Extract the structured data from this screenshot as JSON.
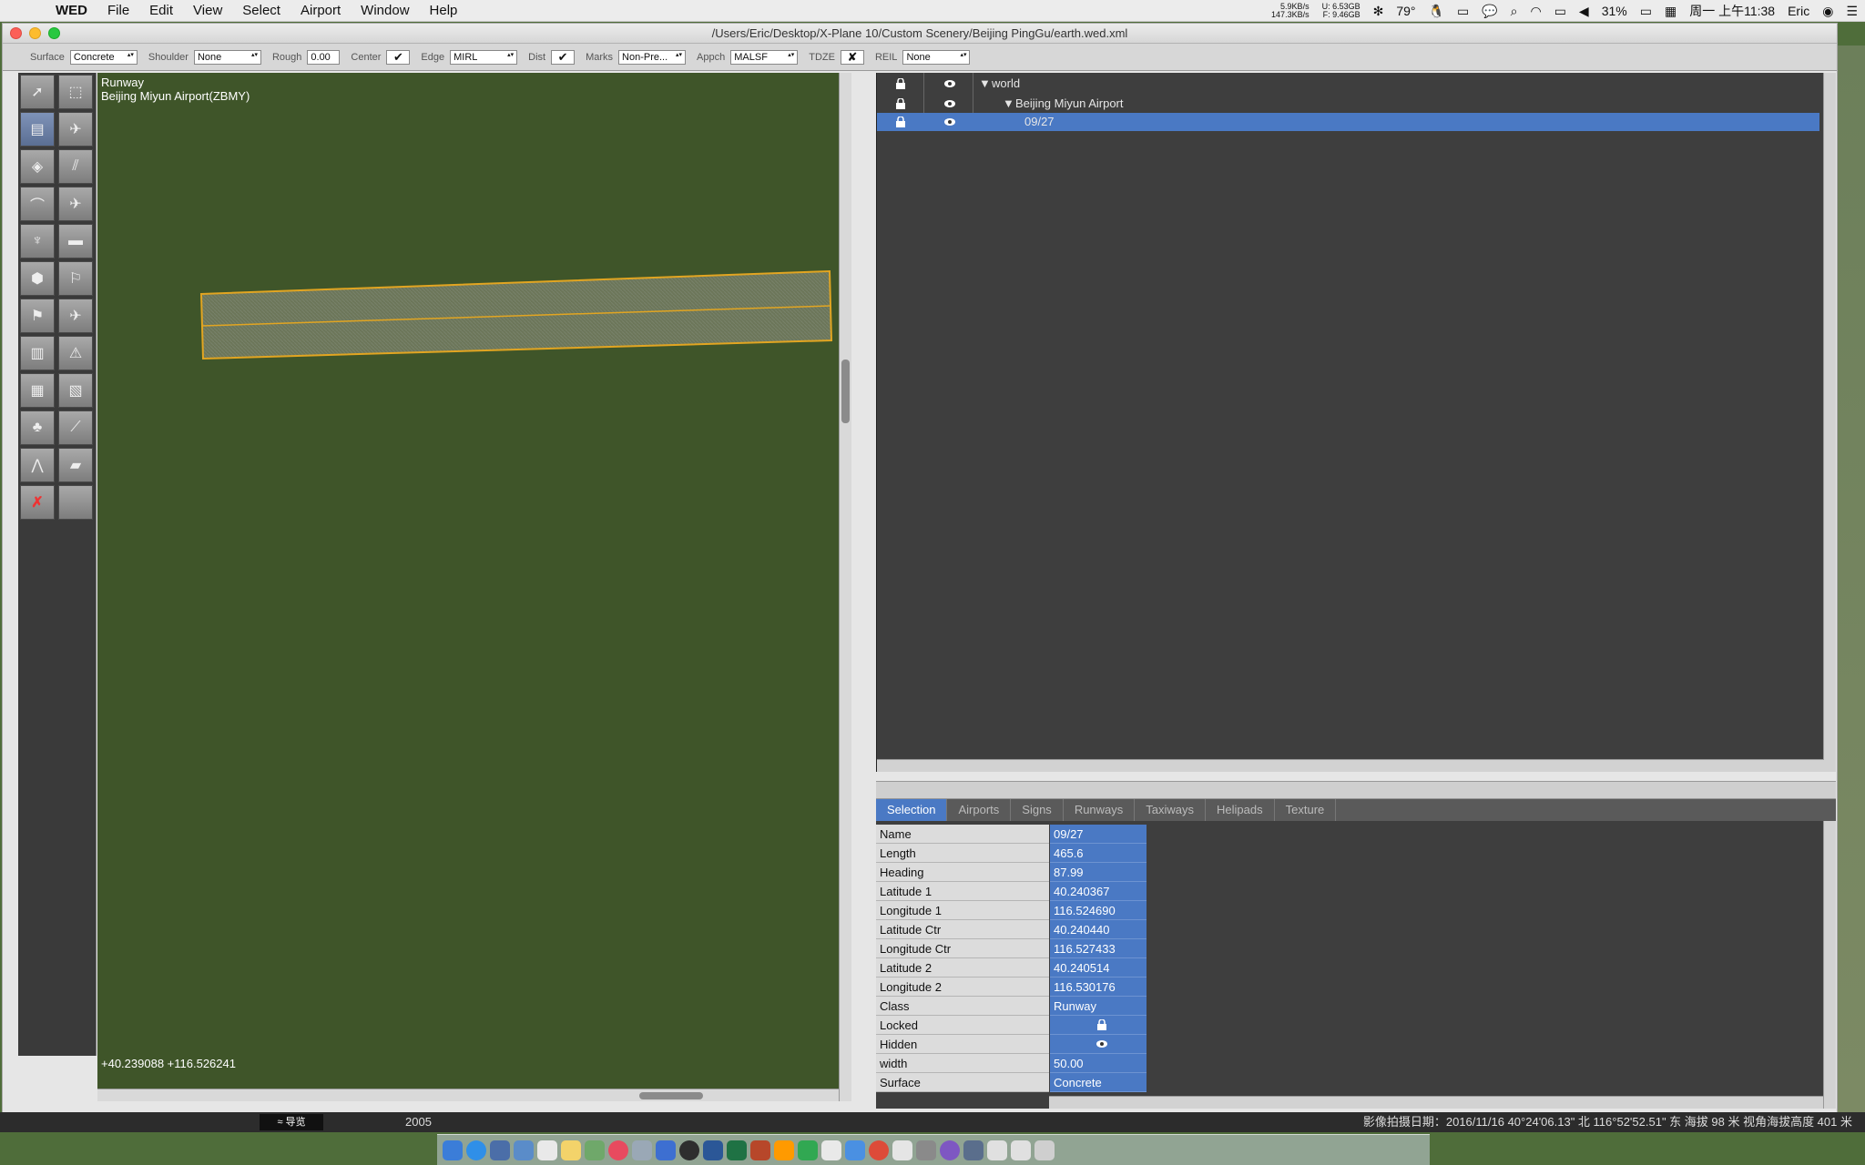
{
  "menubar": {
    "app": "WED",
    "items": [
      "File",
      "Edit",
      "View",
      "Select",
      "Airport",
      "Window",
      "Help"
    ],
    "net_up": "5.9KB/s",
    "net_down": "147.3KB/s",
    "mem_u": "U: 6.53GB",
    "mem_f": "F: 9.46GB",
    "temp": "79°",
    "battery": "31%",
    "clock": "周一 上午11:38",
    "user": "Eric"
  },
  "window": {
    "title": "/Users/Eric/Desktop/X-Plane 10/Custom Scenery/Beijing PingGu/earth.wed.xml"
  },
  "toolbar": {
    "surface_label": "Surface",
    "surface_value": "Concrete",
    "shoulder_label": "Shoulder",
    "shoulder_value": "None",
    "rough_label": "Rough",
    "rough_value": "0.00",
    "center_label": "Center",
    "center_value": "✔",
    "edge_label": "Edge",
    "edge_value": "MIRL",
    "dist_label": "Dist",
    "dist_value": "✔",
    "marks_label": "Marks",
    "marks_value": "Non-Pre...",
    "appch_label": "Appch",
    "appch_value": "MALSF",
    "tdze_label": "TDZE",
    "tdze_value": "✘",
    "reil_label": "REIL",
    "reil_value": "None"
  },
  "map": {
    "line1": "Runway",
    "line2": "Beijing Miyun Airport(ZBMY)",
    "coords": "+40.239088 +116.526241"
  },
  "hierarchy": {
    "rows": [
      {
        "name": "world"
      },
      {
        "name": "Beijing Miyun Airport"
      },
      {
        "name": "09/27"
      }
    ]
  },
  "tabs": [
    "Selection",
    "Airports",
    "Signs",
    "Runways",
    "Taxiways",
    "Helipads",
    "Texture"
  ],
  "properties": [
    {
      "key": "Name",
      "value": "09/27"
    },
    {
      "key": "Length",
      "value": "465.6"
    },
    {
      "key": "Heading",
      "value": "87.99"
    },
    {
      "key": "Latitude 1",
      "value": "40.240367"
    },
    {
      "key": "Longitude 1",
      "value": "116.524690"
    },
    {
      "key": "Latitude Ctr",
      "value": "40.240440"
    },
    {
      "key": "Longitude Ctr",
      "value": "116.527433"
    },
    {
      "key": "Latitude 2",
      "value": "40.240514"
    },
    {
      "key": "Longitude 2",
      "value": "116.530176"
    },
    {
      "key": "Class",
      "value": "Runway"
    },
    {
      "key": "Locked",
      "value": ""
    },
    {
      "key": "Hidden",
      "value": ""
    },
    {
      "key": "width",
      "value": "50.00"
    },
    {
      "key": "Surface",
      "value": "Concrete"
    }
  ],
  "ge_status": {
    "nav": "≈ 导览",
    "year": "2005",
    "info": "影像拍摄日期：2016/11/16    40°24'06.13\" 北  116°52'52.51\" 东  海拔   98 米      视角海拔高度   401 米"
  },
  "colors": {
    "map_bg": "#3f5529",
    "selection_blue": "#4a79c4",
    "runway_outline": "#e2a521"
  }
}
